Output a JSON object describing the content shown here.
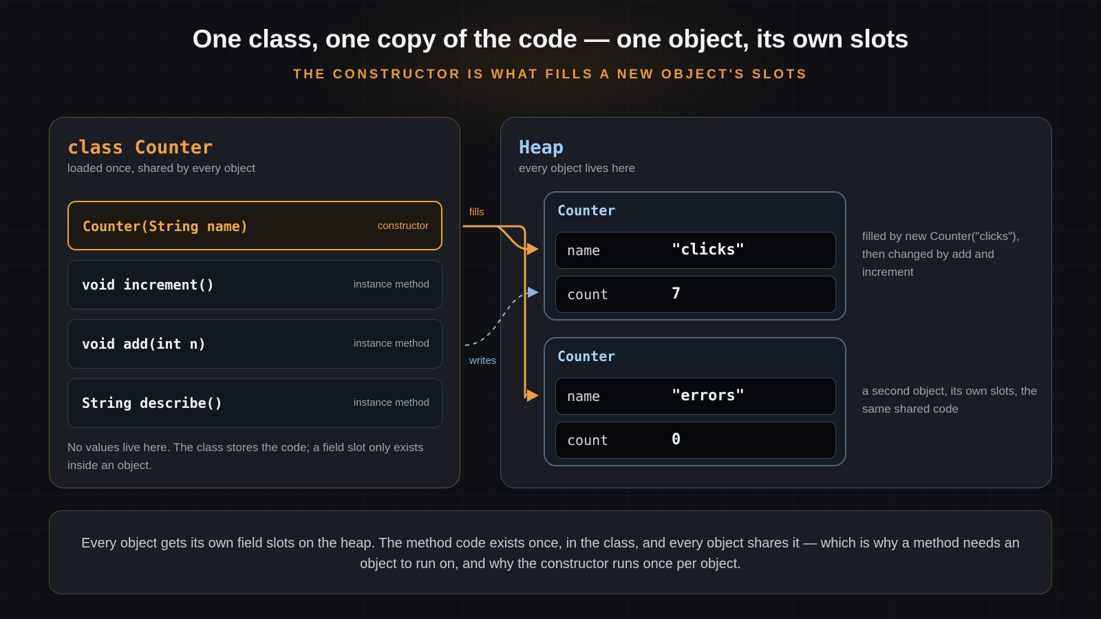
{
  "header": {
    "title": "One class, one copy of the code — one object, its own slots",
    "subtitle": "THE CONSTRUCTOR IS WHAT FILLS A NEW OBJECT'S SLOTS"
  },
  "class_panel": {
    "title": "class Counter",
    "subtitle": "loaded once, shared by every object",
    "methods": [
      {
        "signature": "Counter(String name)",
        "kind": "constructor"
      },
      {
        "signature": "void increment()",
        "kind": "instance method"
      },
      {
        "signature": "void add(int n)",
        "kind": "instance method"
      },
      {
        "signature": "String describe()",
        "kind": "instance method"
      }
    ],
    "note": "No values live here. The class stores the code; a field slot only exists inside an object."
  },
  "arrows": {
    "fills": "fills",
    "writes": "writes"
  },
  "heap_panel": {
    "title": "Heap",
    "subtitle": "every object lives here",
    "objects": [
      {
        "label": "Counter",
        "fields": [
          {
            "name": "name",
            "value": "\"clicks\""
          },
          {
            "name": "count",
            "value": "7"
          }
        ],
        "note": "filled by new Counter(\"clicks\"), then changed by add and increment"
      },
      {
        "label": "Counter",
        "fields": [
          {
            "name": "name",
            "value": "\"errors\""
          },
          {
            "name": "count",
            "value": "0"
          }
        ],
        "note": "a second object, its own slots, the same shared code"
      }
    ]
  },
  "footer": {
    "text": "Every object gets its own field slots on the heap. The method code exists once, in the class, and every object shares it — which is why a method needs an object to run on, and why the constructor runs once per object."
  },
  "colors": {
    "accent_orange": "#eea23c",
    "accent_blue": "#9fcdf0",
    "background": "#0e1013"
  }
}
